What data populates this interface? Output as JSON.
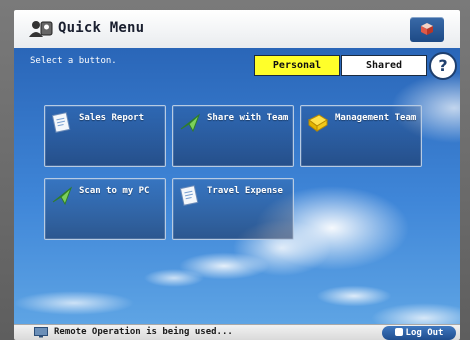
{
  "titlebar": {
    "title": "Quick Menu",
    "user_icon": "users-icon",
    "top_button_icon": "cube-icon"
  },
  "main": {
    "prompt": "Select a button.",
    "segments": {
      "personal": "Personal",
      "shared": "Shared",
      "selected": "Personal"
    },
    "help_label": "?",
    "tiles": [
      {
        "label": "Sales Report",
        "icon": "document-icon"
      },
      {
        "label": "Share with Team",
        "icon": "send-icon"
      },
      {
        "label": "Management Team",
        "icon": "folder-icon"
      },
      {
        "label": "Scan to my PC",
        "icon": "send-icon"
      },
      {
        "label": "Travel Expense",
        "icon": "document-icon"
      }
    ]
  },
  "statusbar": {
    "message": "Remote Operation is being used...",
    "logout_label": "Log Out"
  },
  "colors": {
    "accent_yellow": "#ffff2a",
    "sky_blue": "#3f86d8",
    "button_blue": "#1d4a86"
  }
}
